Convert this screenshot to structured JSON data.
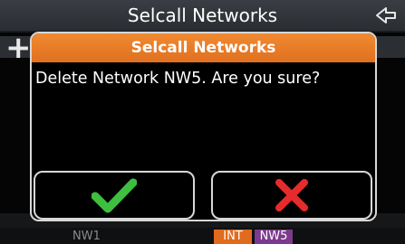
{
  "header": {
    "title": "Selcall Networks",
    "back_icon": "back-arrow-icon"
  },
  "dialog": {
    "title": "Selcall Networks",
    "message": "Delete Network NW5. Are you sure?",
    "confirm_icon": "checkmark-icon",
    "cancel_icon": "x-icon",
    "colors": {
      "title_bar": "#e87a28",
      "confirm": "#3fbf3f",
      "cancel": "#e52b2b"
    }
  },
  "background": {
    "add_icon": "plus-icon",
    "row_label": "NW1",
    "badges": [
      "INT",
      "NW5"
    ]
  }
}
